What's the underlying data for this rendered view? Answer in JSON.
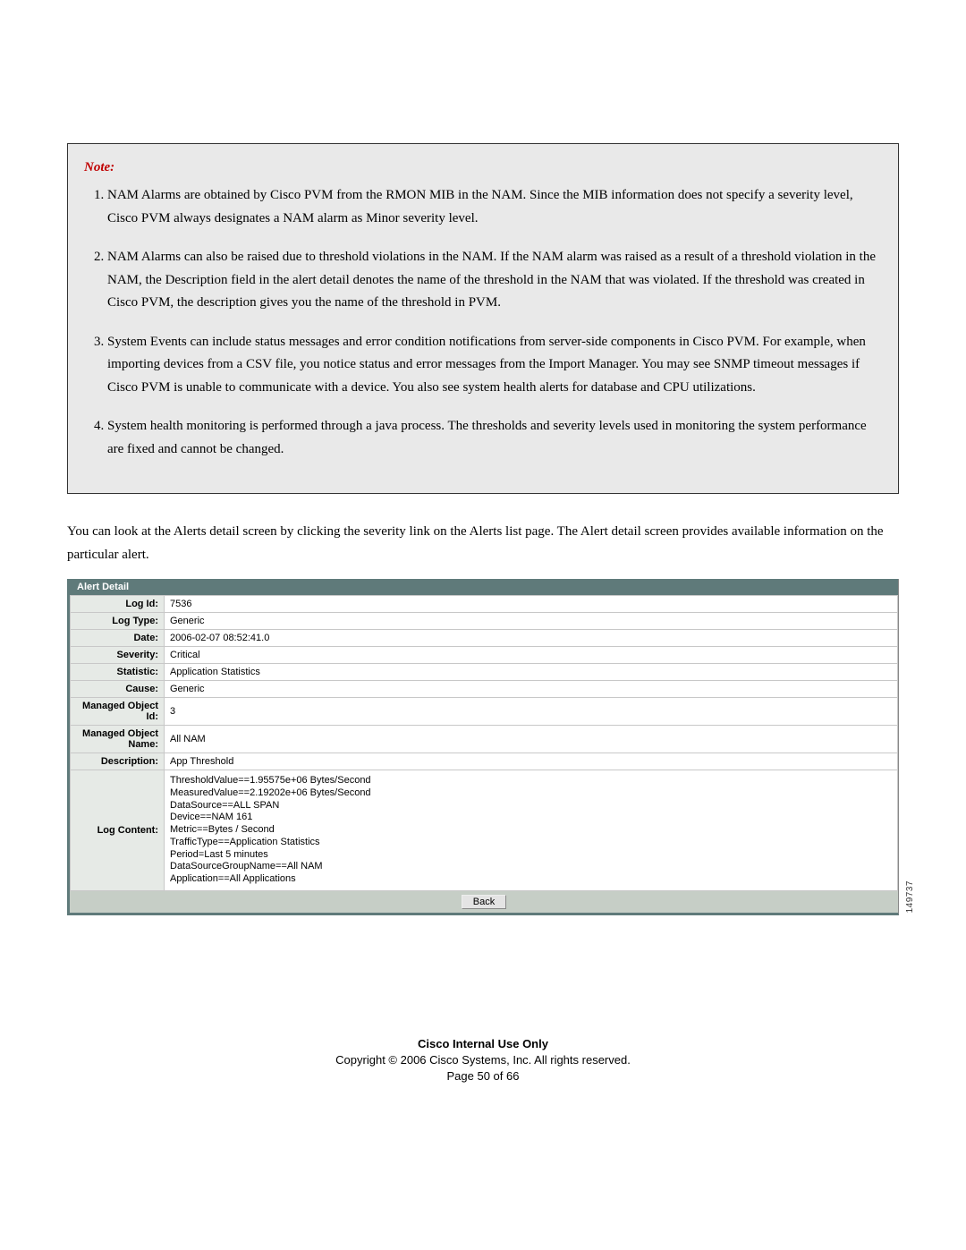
{
  "note": {
    "heading": "Note:",
    "items": [
      "NAM Alarms are obtained by Cisco PVM from the RMON MIB in the NAM. Since the MIB information does not specify a severity level, Cisco PVM always designates a NAM alarm as Minor severity level.",
      "NAM Alarms can also be raised due to threshold violations in the NAM. If the NAM alarm was raised as a result of a threshold violation in the NAM, the Description field in the alert detail denotes the name of the threshold in the NAM that was violated. If the threshold was created in Cisco PVM, the description gives you the name of the threshold in PVM.",
      "System Events can include status messages and error condition notifications from server-side components in Cisco PVM. For example, when importing devices from a CSV file, you notice status and error messages from the Import Manager. You may see SNMP timeout messages if Cisco PVM is unable to communicate with a device. You also see system health alerts for database and CPU utilizations.",
      "System health monitoring is performed through a java process. The thresholds and severity levels used in monitoring the system performance are fixed and cannot be changed."
    ]
  },
  "body_paragraph": "You can look at the Alerts detail screen by clicking the severity link on the Alerts list page. The Alert detail screen provides available information on the particular alert.",
  "alert_detail": {
    "title": "Alert Detail",
    "rows": [
      {
        "label": "Log Id:",
        "value": "7536"
      },
      {
        "label": "Log Type:",
        "value": "Generic"
      },
      {
        "label": "Date:",
        "value": "2006-02-07 08:52:41.0"
      },
      {
        "label": "Severity:",
        "value": "Critical"
      },
      {
        "label": "Statistic:",
        "value": "Application Statistics"
      },
      {
        "label": "Cause:",
        "value": "Generic"
      },
      {
        "label": "Managed Object Id:",
        "value": "3"
      },
      {
        "label": "Managed Object Name:",
        "value": "All NAM"
      },
      {
        "label": "Description:",
        "value": "App Threshold"
      }
    ],
    "log_content_label": "Log Content:",
    "log_content_lines": [
      "ThresholdValue==1.95575e+06 Bytes/Second",
      "MeasuredValue==2.19202e+06 Bytes/Second",
      "DataSource==ALL SPAN",
      "Device==NAM 161",
      "Metric==Bytes / Second",
      "TrafficType==Application Statistics",
      "Period=Last 5 minutes",
      "DataSourceGroupName==All NAM",
      "Application==All Applications"
    ],
    "back_label": "Back",
    "figure_id": "149737"
  },
  "footer": {
    "line1": "Cisco Internal Use Only",
    "line2": "Copyright © 2006 Cisco Systems, Inc. All rights reserved.",
    "line3": "Page 50 of 66"
  }
}
